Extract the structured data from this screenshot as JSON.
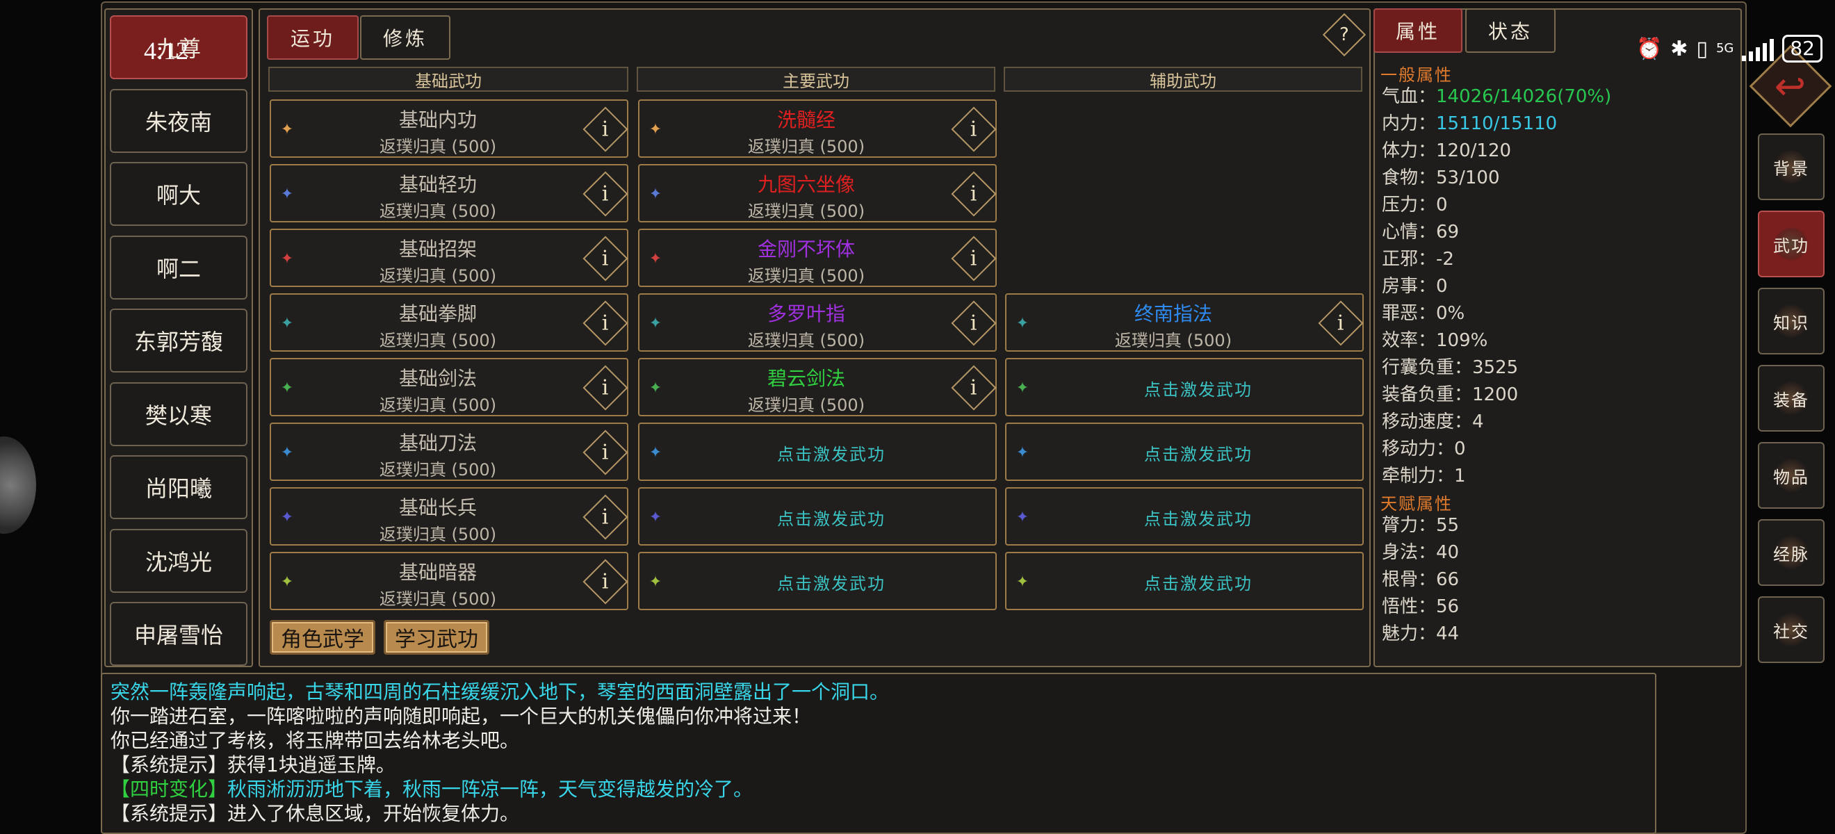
{
  "status_bar": {
    "icons": [
      "alarm-icon",
      "bluetooth-icon",
      "vibrate-icon",
      "5g-icon",
      "signal-icon"
    ],
    "network": "5G",
    "battery": "82"
  },
  "time_overlay": "4:12",
  "characters": [
    {
      "name": "九尊",
      "selected": true
    },
    {
      "name": "朱夜南"
    },
    {
      "name": "啊大"
    },
    {
      "name": "啊二"
    },
    {
      "name": "东郭芳馥"
    },
    {
      "name": "樊以寒"
    },
    {
      "name": "尚阳曦"
    },
    {
      "name": "沈鸿光"
    },
    {
      "name": "申屠雪怡"
    }
  ],
  "tabs": {
    "practice": "运功",
    "train": "修炼"
  },
  "help_symbol": "?",
  "columns": {
    "basic": "基础武功",
    "main": "主要武功",
    "aux": "辅助武功"
  },
  "basic_skills": [
    {
      "name": "基础内功",
      "level": "返璞归真 (500)",
      "icon": "inner-power-icon",
      "color": "#e0a050"
    },
    {
      "name": "基础轻功",
      "level": "返璞归真 (500)",
      "icon": "light-foot-icon",
      "color": "#5a7ad8"
    },
    {
      "name": "基础招架",
      "level": "返璞归真 (500)",
      "icon": "parry-icon",
      "color": "#d04040"
    },
    {
      "name": "基础拳脚",
      "level": "返璞归真 (500)",
      "icon": "fist-icon",
      "color": "#3aa0a0"
    },
    {
      "name": "基础剑法",
      "level": "返璞归真 (500)",
      "icon": "sword-icon",
      "color": "#48b050"
    },
    {
      "name": "基础刀法",
      "level": "返璞归真 (500)",
      "icon": "blade-icon",
      "color": "#3a8ad0"
    },
    {
      "name": "基础长兵",
      "level": "返璞归真 (500)",
      "icon": "spear-icon",
      "color": "#5a5ad0"
    },
    {
      "name": "基础暗器",
      "level": "返璞归真 (500)",
      "icon": "dart-icon",
      "color": "#a0c040"
    }
  ],
  "main_skills": [
    {
      "name": "洗髓经",
      "level": "返璞归真 (500)",
      "color": "#e02020",
      "icon": "inner-power-icon",
      "icon_color": "#e0a050"
    },
    {
      "name": "九图六坐像",
      "level": "返璞归真 (500)",
      "color": "#e02020",
      "icon": "light-foot-icon",
      "icon_color": "#5a7ad8"
    },
    {
      "name": "金刚不坏体",
      "level": "返璞归真 (500)",
      "color": "#a030e0",
      "icon": "parry-icon",
      "icon_color": "#d04040"
    },
    {
      "name": "多罗叶指",
      "level": "返璞归真 (500)",
      "color": "#a030e0",
      "icon": "fist-icon",
      "icon_color": "#3aa0a0"
    },
    {
      "name": "碧云剑法",
      "level": "返璞归真 (500)",
      "color": "#30d040",
      "icon": "sword-icon",
      "icon_color": "#48b050"
    }
  ],
  "aux_skill": {
    "name": "终南指法",
    "level": "返璞归真 (500)",
    "color": "#2f8af0",
    "icon": "fist-icon",
    "icon_color": "#3aa0a0"
  },
  "activate_label": "点击激发武功",
  "bottom_buttons": {
    "character_martial": "角色武学",
    "learn_martial": "学习武功"
  },
  "attr_tabs": {
    "attributes": "属性",
    "status": "状态"
  },
  "general_title": "一般属性",
  "general_attrs": [
    {
      "label": "气血：",
      "value": "14026/14026(70%)",
      "cls": "green"
    },
    {
      "label": "内力：",
      "value": "15110/15110",
      "cls": "cyan"
    },
    {
      "label": "体力：",
      "value": "120/120"
    },
    {
      "label": "食物：",
      "value": "53/100"
    },
    {
      "label": "压力：",
      "value": "0"
    },
    {
      "label": "心情：",
      "value": "69"
    },
    {
      "label": "正邪：",
      "value": "-2"
    },
    {
      "label": "房事：",
      "value": "0"
    },
    {
      "label": "罪恶：",
      "value": "0%"
    },
    {
      "label": "效率：",
      "value": "109%"
    },
    {
      "label": "行囊负重：",
      "value": "3525"
    },
    {
      "label": "装备负重：",
      "value": "1200"
    },
    {
      "label": "移动速度：",
      "value": "4"
    },
    {
      "label": "移动力：",
      "value": "0"
    },
    {
      "label": "牵制力：",
      "value": "1"
    }
  ],
  "talent_title": "天赋属性",
  "talent_attrs": [
    {
      "label": "膂力：",
      "value": "55"
    },
    {
      "label": "身法：",
      "value": "40"
    },
    {
      "label": "根骨：",
      "value": "66"
    },
    {
      "label": "悟性：",
      "value": "56"
    },
    {
      "label": "魅力：",
      "value": "44"
    }
  ],
  "side_menu": [
    {
      "label": "背景"
    },
    {
      "label": "武功",
      "selected": true
    },
    {
      "label": "知识"
    },
    {
      "label": "装备"
    },
    {
      "label": "物品"
    },
    {
      "label": "经脉"
    },
    {
      "label": "社交"
    }
  ],
  "log": [
    {
      "text": "突然一阵轰隆声响起，古琴和四周的石柱缓缓沉入地下，琴室的西面洞壁露出了一个洞口。",
      "color": "#38d6e8"
    },
    {
      "text": "你一踏进石室，一阵喀啦啦的声响随即响起，一个巨大的机关傀儡向你冲将过来！",
      "color": "#f0ede6"
    },
    {
      "text": "你已经通过了考核，将玉牌带回去给林老头吧。",
      "color": "#f0ede6"
    },
    {
      "text": "【系统提示】获得1块逍遥玉牌。",
      "color": "#f0ede6"
    },
    {
      "prefix": "【四时变化】",
      "prefix_color": "#30d040",
      "text": "秋雨淅沥沥地下着，秋雨一阵凉一阵，天气变得越发的冷了。",
      "color": "#38d6e8"
    },
    {
      "text": "【系统提示】进入了休息区域，开始恢复体力。",
      "color": "#f0ede6"
    }
  ]
}
